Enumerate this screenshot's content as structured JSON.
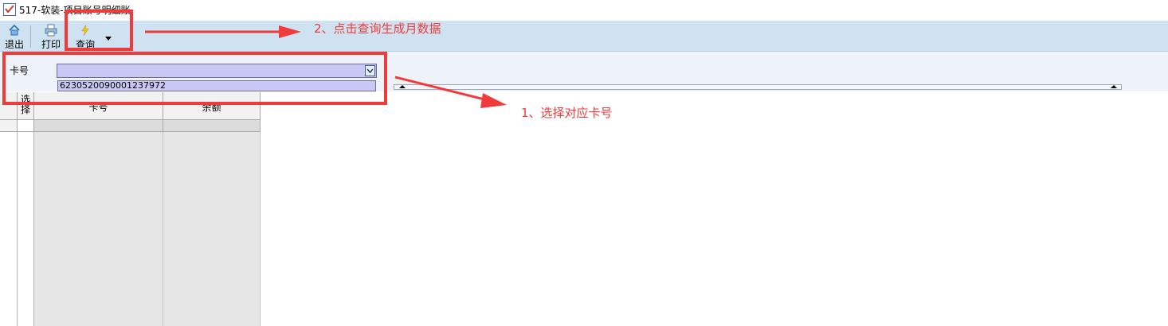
{
  "window": {
    "title": "517-软装-项目账号明细账"
  },
  "toolbar": {
    "exit_label": "退出",
    "print_label": "打印",
    "query_label": "查询"
  },
  "form": {
    "card_label": "卡号",
    "card_value": "",
    "card_option": "6230520090001237972"
  },
  "grid": {
    "columns": [
      "选择",
      "卡号",
      "余额"
    ]
  },
  "annotations": {
    "step1": "1、选择对应卡号",
    "step2": "2、点击查询生成月数据",
    "color": "#ef3b3b"
  },
  "theme": {
    "toolbar_bg": "#cfe2f1",
    "select_bg": "#c9c8f4"
  }
}
